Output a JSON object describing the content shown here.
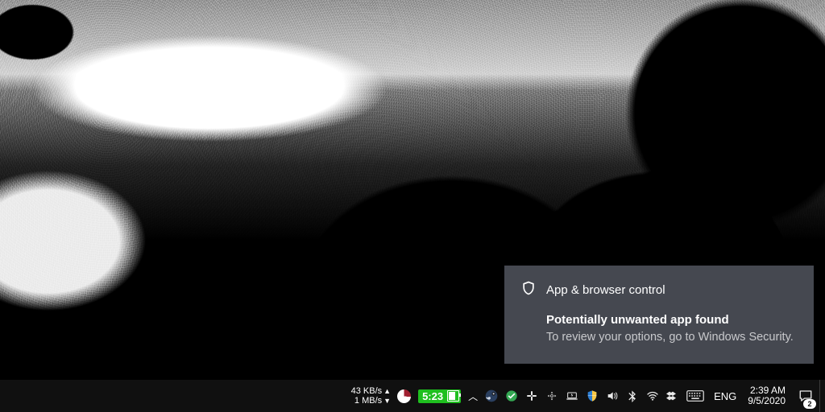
{
  "notification": {
    "source": "App & browser control",
    "heading": "Potentially unwanted app found",
    "body": "To review your options, go to Windows Security."
  },
  "netmeter": {
    "down_value": "43 KB/s",
    "up_value": "1 MB/s"
  },
  "battery_time": "5:23",
  "language": "ENG",
  "clock": {
    "time": "2:39 AM",
    "date": "9/5/2020"
  },
  "action_center_count": "2"
}
